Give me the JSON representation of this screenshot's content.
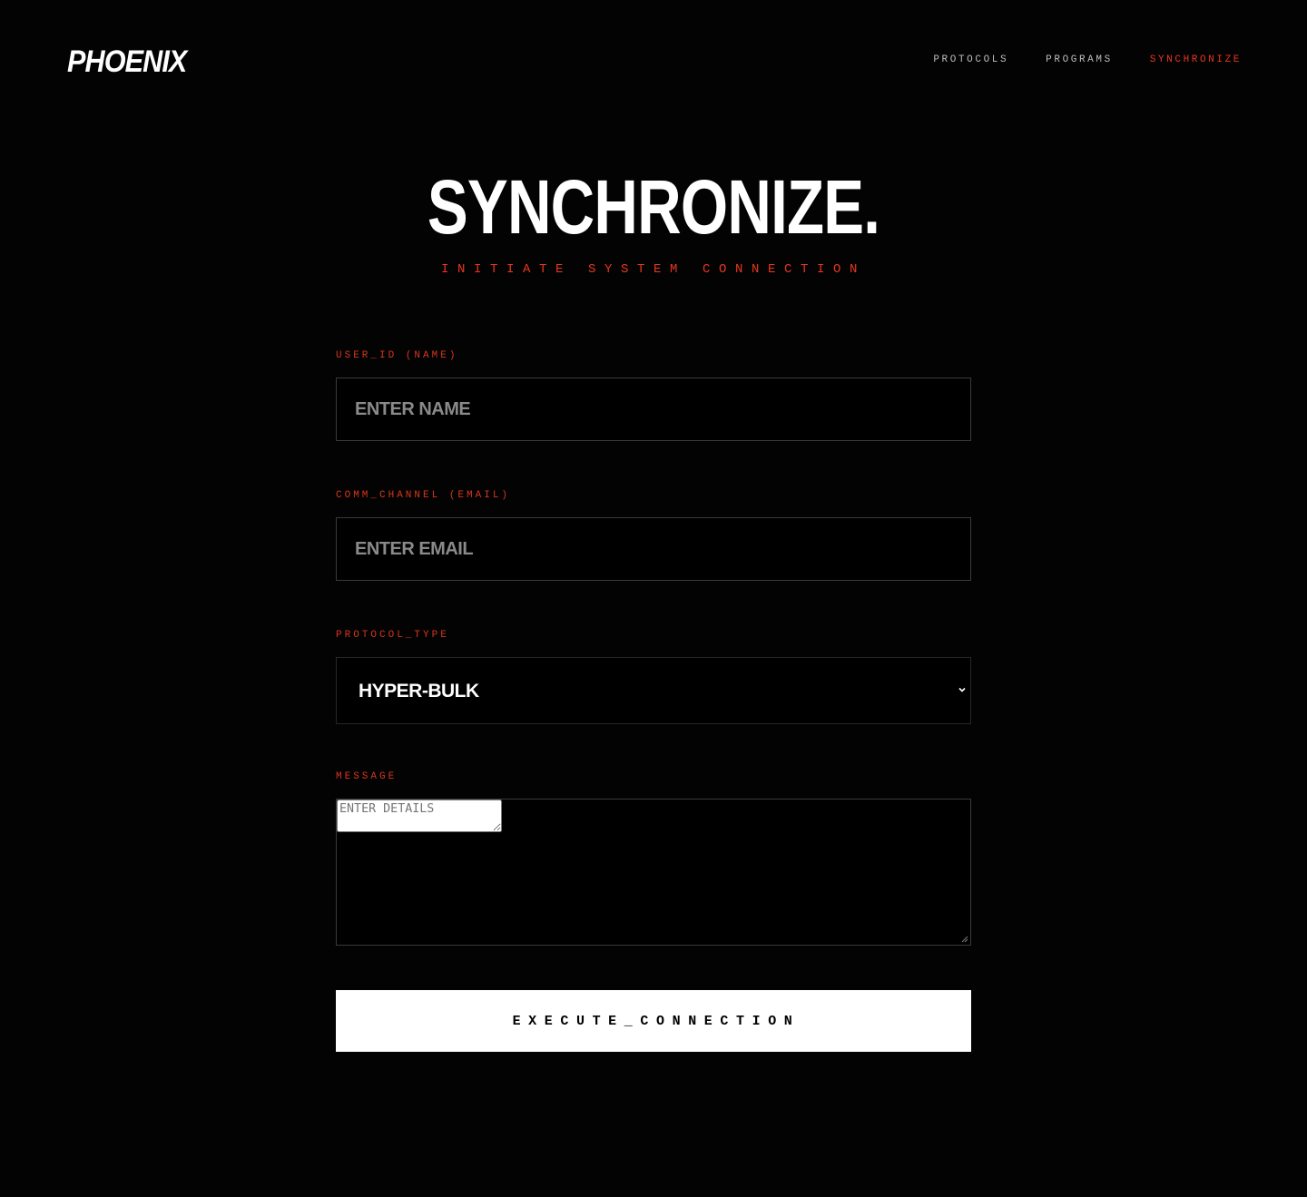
{
  "brand": {
    "logo": "PHOENIX"
  },
  "nav": {
    "items": [
      {
        "label": "PROTOCOLS"
      },
      {
        "label": "PROGRAMS"
      },
      {
        "label": "SYNCHRONIZE"
      }
    ],
    "active": "SYNCHRONIZE"
  },
  "hero": {
    "title": "SYNCHRONIZE.",
    "subtitle": "INITIATE SYSTEM CONNECTION"
  },
  "form": {
    "name": {
      "label": "USER_ID (NAME)",
      "placeholder": "ENTER NAME",
      "value": ""
    },
    "email": {
      "label": "COMM_CHANNEL (EMAIL)",
      "placeholder": "ENTER EMAIL",
      "value": ""
    },
    "protocol": {
      "label": "PROTOCOL_TYPE",
      "selected": "HYPER-BULK"
    },
    "message": {
      "label": "MESSAGE",
      "placeholder": "ENTER DETAILS",
      "value": ""
    },
    "submit_label": "EXECUTE_CONNECTION"
  },
  "icons": {
    "select_arrow": "chevron-down-icon",
    "textarea_grip": "resize-grip-icon"
  },
  "colors": {
    "background": "#030303",
    "accent": "#e8371d",
    "text": "#ffffff",
    "muted_text": "#8a8a8a",
    "border": "#3a3a3a",
    "button_bg": "#ffffff",
    "button_text": "#000000"
  }
}
